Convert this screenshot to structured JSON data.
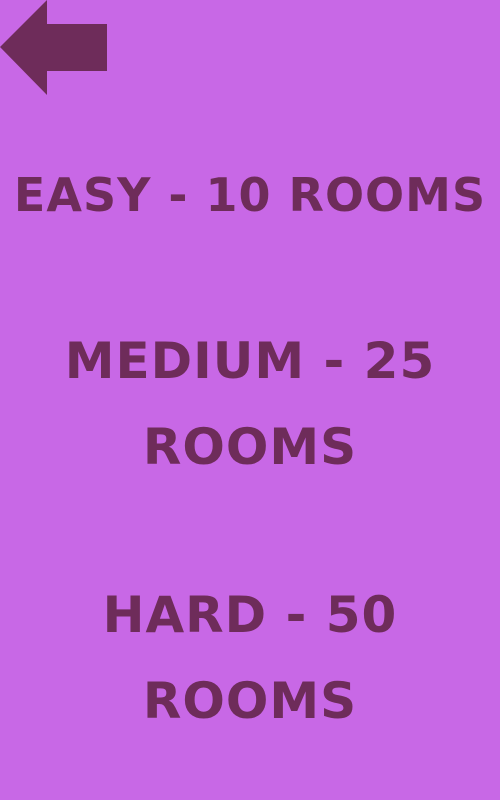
{
  "back": {
    "icon": "arrow-left-icon",
    "color": "#6e2c5a"
  },
  "theme": {
    "background": "#c868e6",
    "text": "#6e2c5a"
  },
  "difficulty_options": [
    {
      "lines": [
        "EASY - 10 ROOMS"
      ]
    },
    {
      "lines": [
        "MEDIUM - 25",
        "ROOMS"
      ]
    },
    {
      "lines": [
        "HARD - 50",
        "ROOMS"
      ]
    }
  ]
}
